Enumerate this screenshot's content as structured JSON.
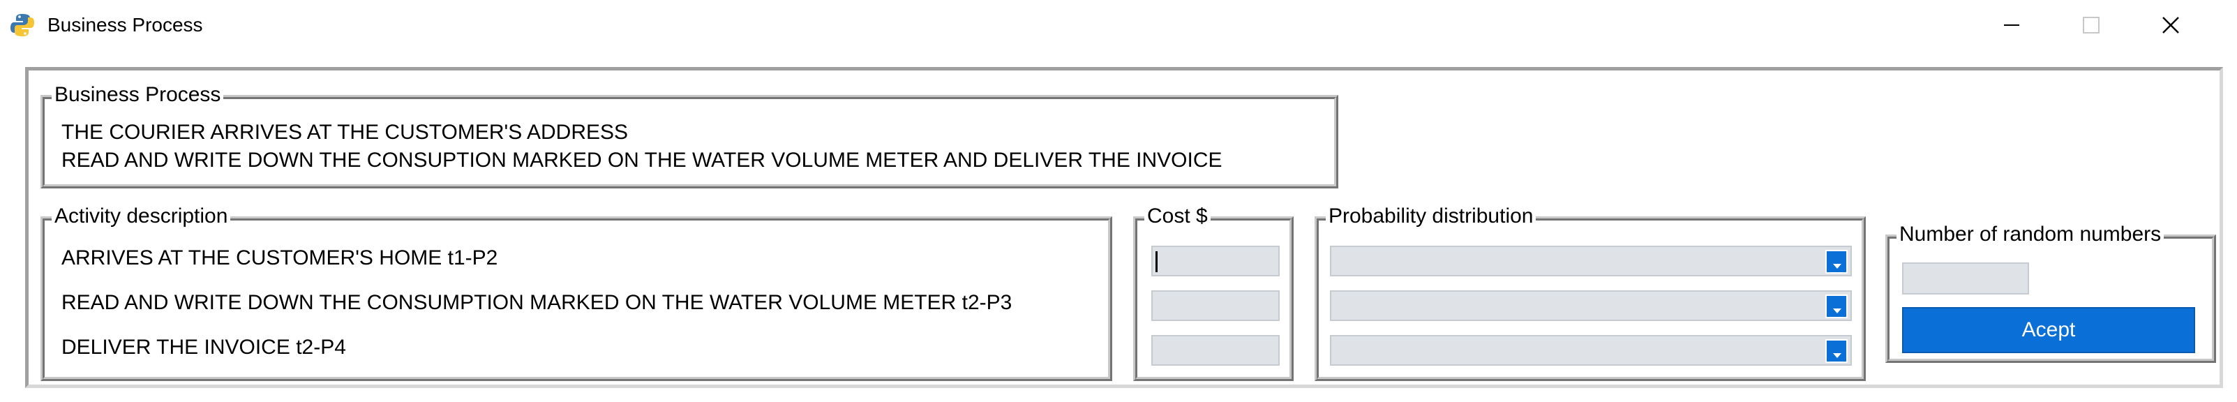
{
  "window": {
    "title": "Business Process",
    "icon": "python-icon",
    "controls": [
      "minimize-icon",
      "maximize-icon",
      "close-icon"
    ]
  },
  "business_process": {
    "legend": "Business Process",
    "lines": [
      "THE COURIER ARRIVES AT THE CUSTOMER'S ADDRESS",
      "READ AND WRITE DOWN THE CONSUPTION MARKED ON THE WATER VOLUME METER AND DELIVER THE INVOICE"
    ]
  },
  "activity": {
    "legend": "Activity description",
    "items": [
      "ARRIVES AT THE CUSTOMER'S HOME t1-P2",
      "READ AND WRITE DOWN THE CONSUMPTION MARKED ON THE WATER VOLUME METER t2-P3",
      "DELIVER THE INVOICE t2-P4"
    ]
  },
  "cost": {
    "legend": "Cost $",
    "values": [
      "",
      "",
      ""
    ]
  },
  "probability": {
    "legend": "Probability distribution",
    "selected": [
      "",
      "",
      ""
    ]
  },
  "random_numbers": {
    "legend": "Number of random numbers",
    "value": "",
    "accept_label": "Acept"
  },
  "colors": {
    "accent": "#0a6fd6",
    "entry_bg": "#dfe3e8",
    "frame": "#a0a0a0"
  }
}
